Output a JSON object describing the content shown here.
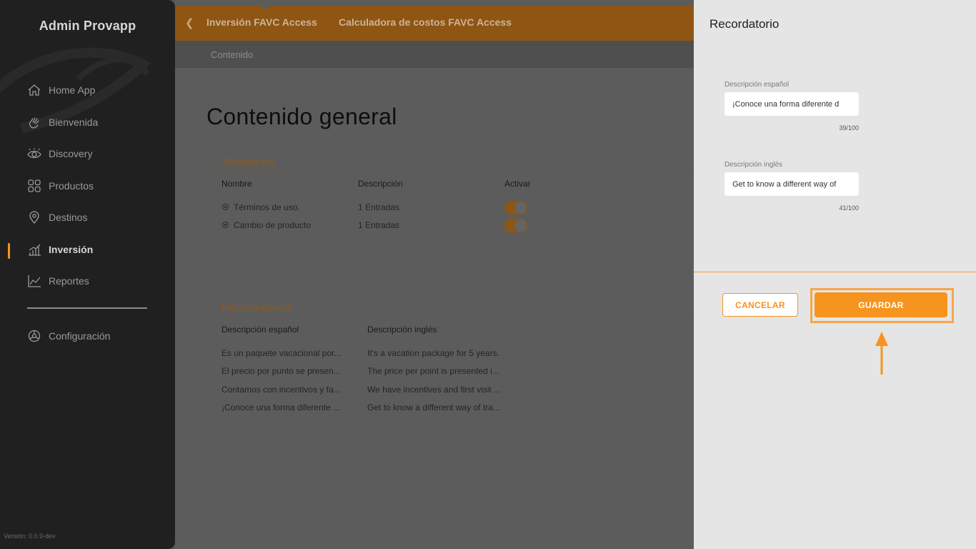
{
  "sidebar": {
    "brand": "Admin Provapp",
    "items": [
      {
        "label": "Home App",
        "icon": "home-icon"
      },
      {
        "label": "Bienvenida",
        "icon": "wave-hand-icon"
      },
      {
        "label": "Discovery",
        "icon": "eye-icon"
      },
      {
        "label": "Productos",
        "icon": "grid-icon"
      },
      {
        "label": "Destinos",
        "icon": "location-pin-icon"
      },
      {
        "label": "Inversión",
        "icon": "bar-chart-icon",
        "active": true
      },
      {
        "label": "Reportes",
        "icon": "line-chart-icon"
      },
      {
        "label": "Configuración",
        "icon": "gear-icon"
      }
    ],
    "version": "Versión: 0.0.9-dev"
  },
  "header": {
    "back_icon": "chevron-left-icon",
    "tabs": [
      "Inversión FAVC Access",
      "Calculadora de costos FAVC Access"
    ],
    "breadcrumb": "Contenido"
  },
  "main": {
    "title": "Contenido general",
    "sections": {
      "title": "Secciones",
      "columns": [
        "Nombre",
        "Descripción",
        "Activar"
      ],
      "rows": [
        {
          "name": "Términos de uso.",
          "description": "1 Entradas",
          "active": true
        },
        {
          "name": "Cambio de producto",
          "description": "1 Entradas",
          "active": true
        }
      ]
    },
    "reminders": {
      "title": "Recordatorios",
      "columns": [
        "Descripción español",
        "Descripción inglés"
      ],
      "rows": [
        {
          "es": "Es un paquete vacacional por...",
          "en": "It's a vacation package for 5 years."
        },
        {
          "es": "El precio por punto se presen...",
          "en": "The price per point is presented i..."
        },
        {
          "es": "Contamos con incentivos y fa...",
          "en": "We have incentives and first visit ..."
        },
        {
          "es": "¡Conoce una forma diferente ...",
          "en": "Get to know a different way of tra..."
        }
      ]
    }
  },
  "drawer": {
    "title": "Recordatorio",
    "field_es": {
      "label": "Descripción español",
      "value": "¡Conoce una forma diferente d",
      "counter": "39/100"
    },
    "field_en": {
      "label": "Descripción inglés",
      "value": "Get to know a different way of",
      "counter": "41/100"
    },
    "cancel_label": "CANCELAR",
    "save_label": "GUARDAR"
  },
  "colors": {
    "accent": "#f7941d",
    "sidebar_bg": "#202020",
    "drawer_bg": "#e5e5e5"
  }
}
